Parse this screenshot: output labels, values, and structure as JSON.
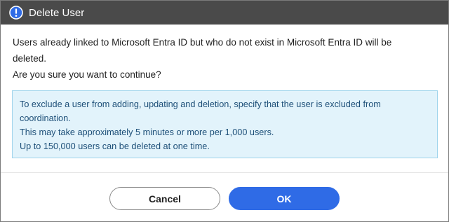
{
  "dialog": {
    "title": "Delete User",
    "title_icon": "exclamation-circle-icon",
    "title_bar_color": "#4a4a4a"
  },
  "message": {
    "line1": "Users already linked to Microsoft Entra ID but who do not exist in Microsoft Entra ID will be deleted.",
    "line2": "Are you sure you want to continue?"
  },
  "info": {
    "lines": [
      "To exclude a user from adding, updating and deletion, specify that the user is excluded from",
      "coordination.",
      "This may take approximately 5 minutes or more per 1,000 users.",
      "Up to 150,000 users can be deleted at one time."
    ],
    "background_color": "#e2f3fb",
    "text_color": "#1d4f78"
  },
  "buttons": {
    "cancel_label": "Cancel",
    "ok_label": "OK",
    "ok_color": "#2f6be6"
  }
}
